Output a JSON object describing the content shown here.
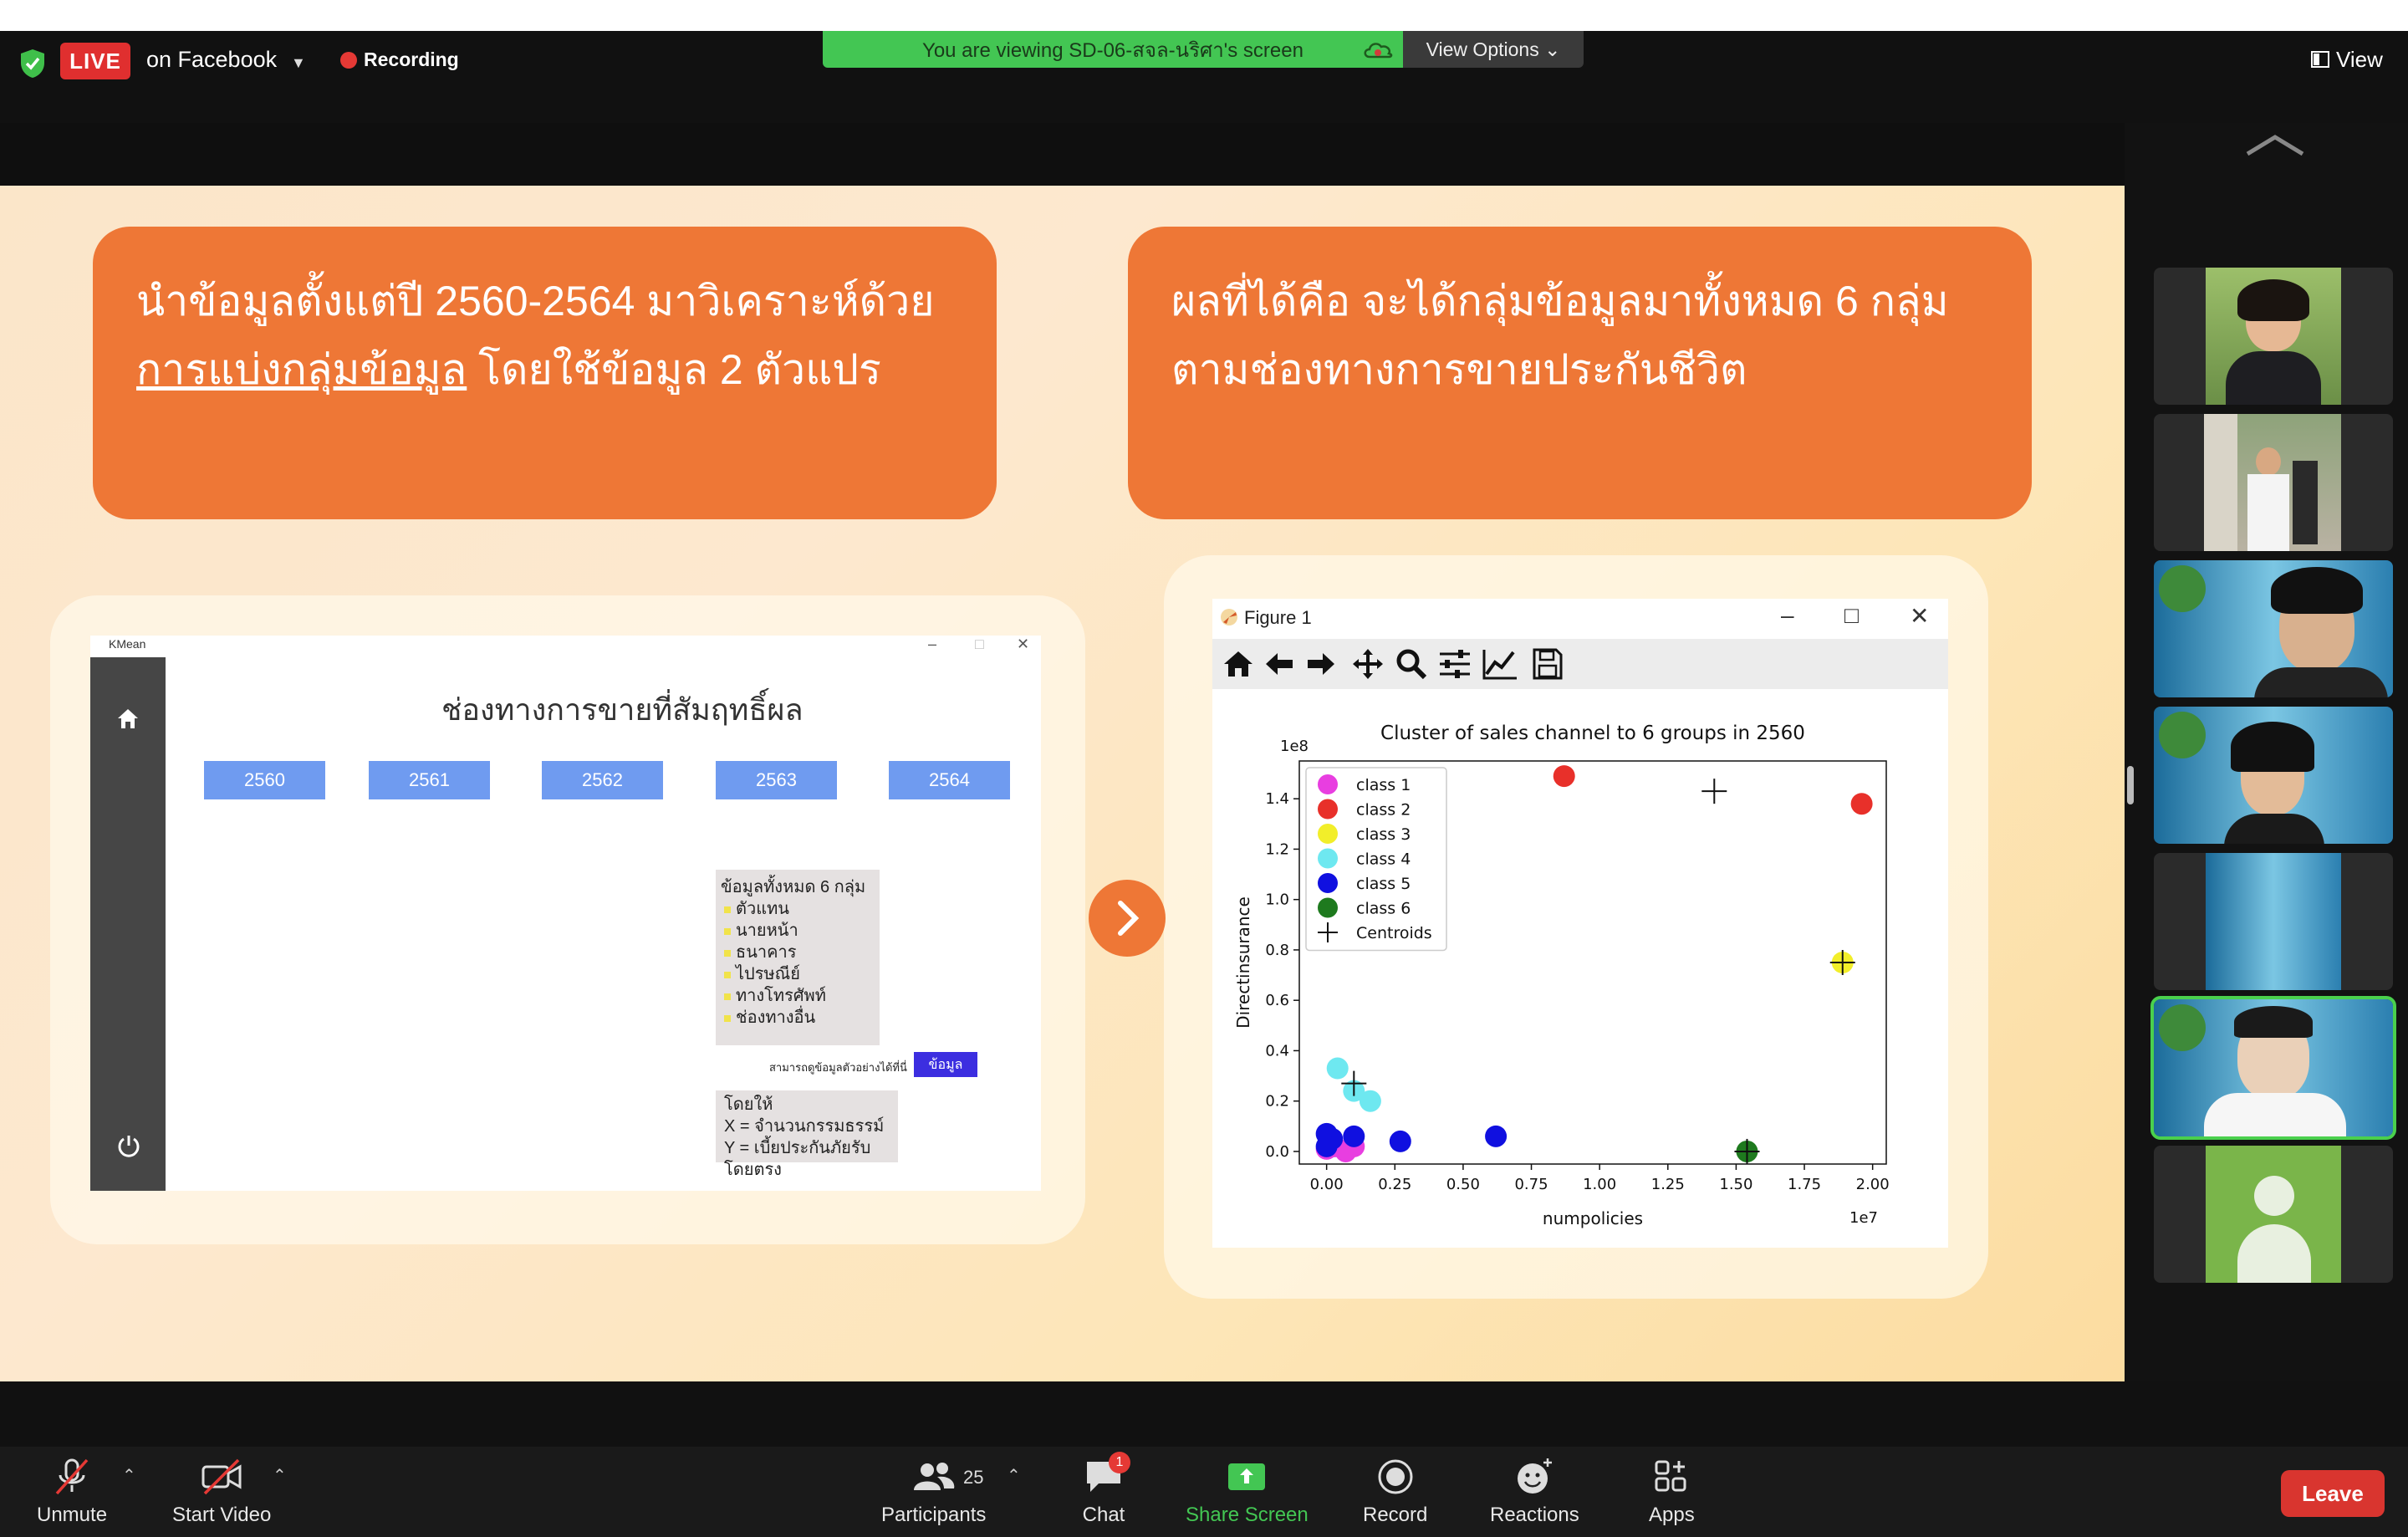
{
  "topbar": {
    "live_badge": "LIVE",
    "live_destination": "on Facebook",
    "recording_label": "Recording",
    "viewing_banner": "You are viewing SD-06-สจล-นริศา's screen",
    "view_options": "View Options ⌄",
    "view_label": "View"
  },
  "slide": {
    "box1_line1": "นำข้อมูลตั้งแต่ปี 2560-2564 มาวิเคราะห์ด้วย",
    "box1_underlined": "การแบ่งกลุ่มข้อมูล",
    "box1_rest": " โดยใช้ข้อมูล 2 ตัวแปร",
    "box2_line1": "ผลที่ได้คือ จะได้กลุ่มข้อมูลมาทั้งหมด 6 กลุ่ม",
    "box2_line2": "ตามช่องทางการขายประกันชีวิต"
  },
  "kmean": {
    "window_title": "KMean",
    "heading": "ช่องทางการขายที่สัมฤทธิ์ผล",
    "years": [
      "2560",
      "2561",
      "2562",
      "2563",
      "2564"
    ],
    "info_title": "ข้อมูลทั้งหมด 6 กลุ่ม",
    "info_items": [
      "ตัวแทน",
      "นายหน้า",
      "ธนาคาร",
      "ไปรษณีย์",
      "ทางโทรศัพท์",
      "ช่องทางอื่น"
    ],
    "note": "สามารถดูข้อมูลตัวอย่างได้ที่นี่",
    "data_button": "ข้อมูล",
    "xy_title": "โดยให้",
    "xy_x": "X = จำนวนกรรมธรรม์",
    "xy_y": "Y = เบี้ยประกันภัยรับโดยตรง"
  },
  "figure": {
    "window_title": "Figure 1"
  },
  "chart_data": {
    "type": "scatter",
    "title": "Cluster of sales channel to 6 groups in 2560",
    "xlabel": "numpolicies",
    "ylabel": "Directinsurance",
    "x_multiplier": "1e7",
    "y_multiplier": "1e8",
    "xlim": [
      -0.1,
      2.05
    ],
    "ylim": [
      -0.05,
      1.55
    ],
    "xticks": [
      "0.00",
      "0.25",
      "0.50",
      "0.75",
      "1.00",
      "1.25",
      "1.50",
      "1.75",
      "2.00"
    ],
    "yticks": [
      "0.0",
      "0.2",
      "0.4",
      "0.6",
      "0.8",
      "1.0",
      "1.2",
      "1.4"
    ],
    "legend_position": "top-left",
    "series": [
      {
        "name": "class 1",
        "color": "#e83ee0",
        "points": [
          [
            0.0,
            0.01
          ],
          [
            0.03,
            0.02
          ],
          [
            0.07,
            0.0
          ],
          [
            0.1,
            0.02
          ]
        ]
      },
      {
        "name": "class 2",
        "color": "#e8302a",
        "points": [
          [
            0.87,
            1.49
          ],
          [
            1.96,
            1.38
          ]
        ]
      },
      {
        "name": "class 3",
        "color": "#f2ee2a",
        "points": [
          [
            1.89,
            0.75
          ]
        ]
      },
      {
        "name": "class 4",
        "color": "#6ee8f0",
        "points": [
          [
            0.04,
            0.33
          ],
          [
            0.1,
            0.24
          ],
          [
            0.16,
            0.2
          ]
        ]
      },
      {
        "name": "class 5",
        "color": "#1010e0",
        "points": [
          [
            0.0,
            0.07
          ],
          [
            0.02,
            0.05
          ],
          [
            0.1,
            0.06
          ],
          [
            0.27,
            0.04
          ],
          [
            0.62,
            0.06
          ],
          [
            0.0,
            0.02
          ]
        ]
      },
      {
        "name": "class 6",
        "color": "#1e7a1e",
        "points": [
          [
            1.54,
            0.0
          ]
        ]
      }
    ],
    "centroids_label": "Centroids",
    "centroids": [
      [
        0.1,
        0.27
      ],
      [
        1.42,
        1.43
      ],
      [
        1.89,
        0.75
      ],
      [
        1.54,
        0.0
      ]
    ]
  },
  "toolbar": {
    "unmute": "Unmute",
    "start_video": "Start Video",
    "participants": "Participants",
    "participants_count": "25",
    "chat": "Chat",
    "chat_badge": "1",
    "share_screen": "Share Screen",
    "record": "Record",
    "reactions": "Reactions",
    "apps": "Apps",
    "leave": "Leave"
  },
  "colors": {
    "accent_orange": "#ee7736",
    "live_red": "#e02f2f",
    "share_green": "#43c653"
  }
}
